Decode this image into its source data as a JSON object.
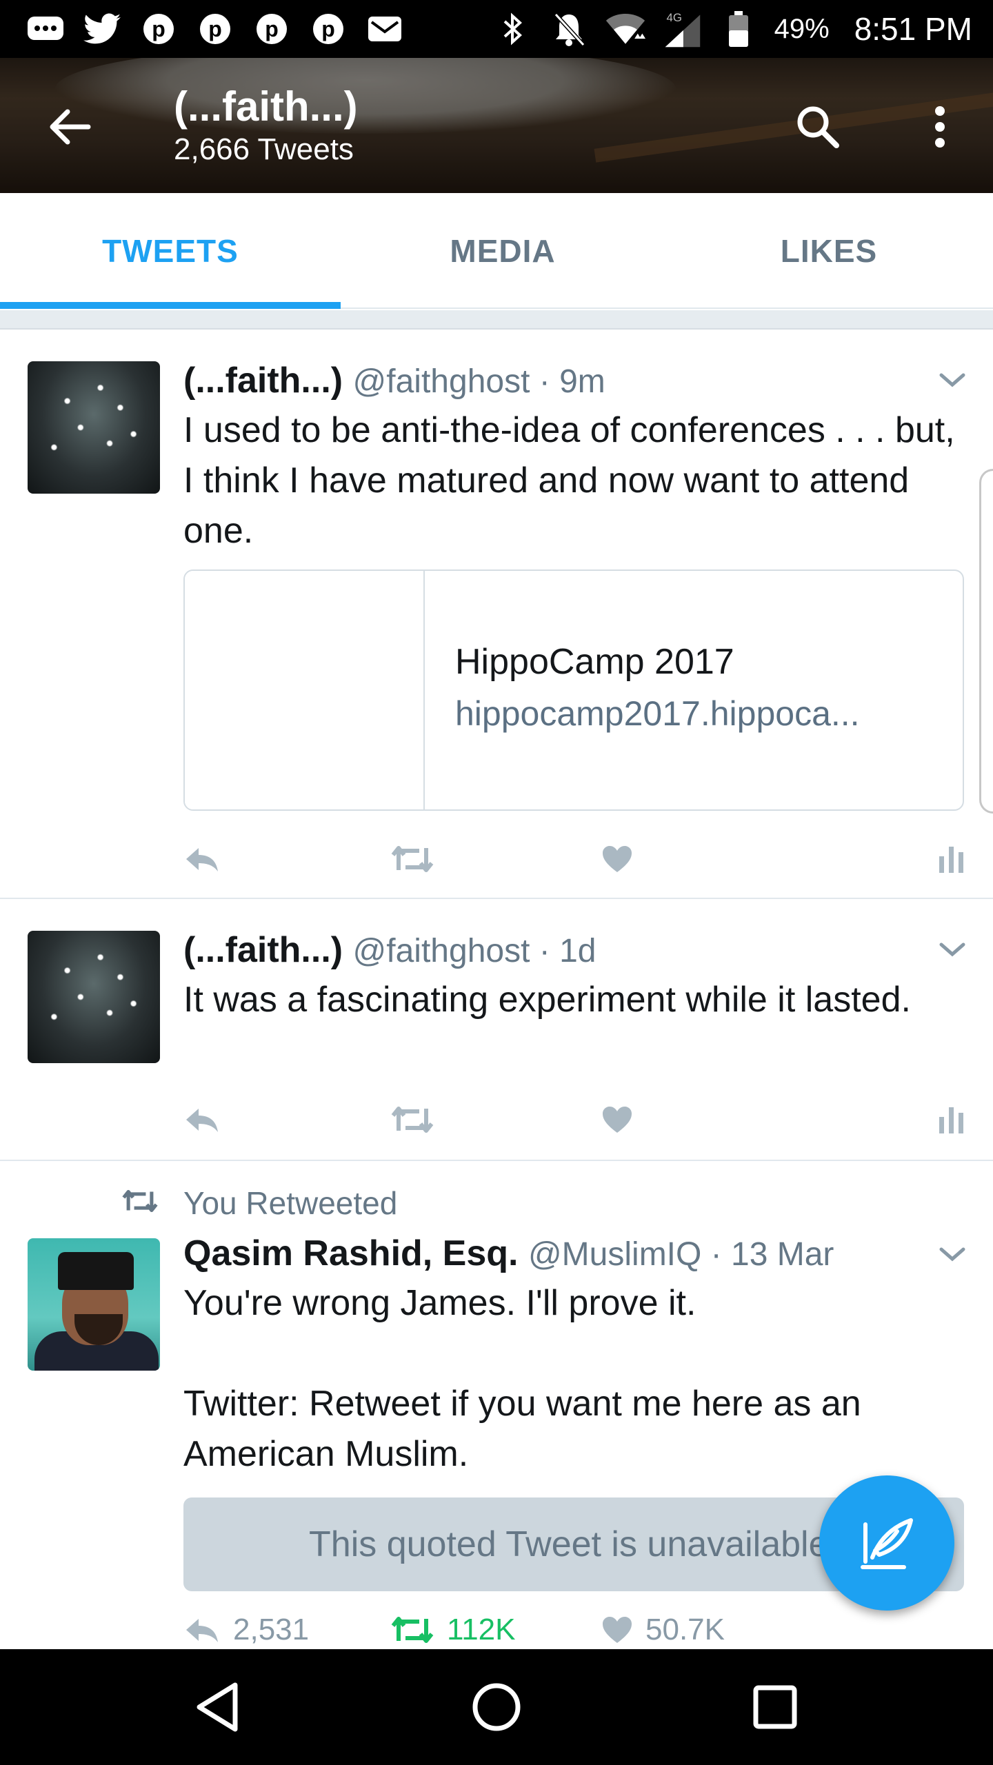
{
  "status_bar": {
    "battery": "49%",
    "time": "8:51 PM",
    "network": "4G"
  },
  "header": {
    "title": "(...faith...)",
    "subtitle": "2,666 Tweets"
  },
  "tabs": [
    {
      "label": "TWEETS",
      "active": true
    },
    {
      "label": "MEDIA",
      "active": false
    },
    {
      "label": "LIKES",
      "active": false
    }
  ],
  "tweets": [
    {
      "name": "(...faith...)",
      "handle": "@faithghost · 9m",
      "text": "I used to be anti-the-idea of conferences . . . but, I think I have matured and now want to attend one.",
      "card": {
        "title": "HippoCamp 2017",
        "url": "hippocamp2017.hippoca..."
      }
    },
    {
      "name": "(...faith...)",
      "handle": "@faithghost · 1d",
      "text": "It was a fascinating experiment while it lasted."
    },
    {
      "retweet_label": "You Retweeted",
      "name": "Qasim Rashid, Esq.",
      "handle": "@MuslimIQ · 13 Mar",
      "text_line1": "You're wrong James. I'll prove it.",
      "text_line2": "Twitter: Retweet if you want me here as an American Muslim.",
      "quoted": "This quoted Tweet is unavailable.",
      "replies": "2,531",
      "retweets": "112K",
      "likes": "50.7K"
    }
  ],
  "colors": {
    "accent": "#1da1f2",
    "retweet_green": "#17bf63",
    "muted": "#657786"
  }
}
